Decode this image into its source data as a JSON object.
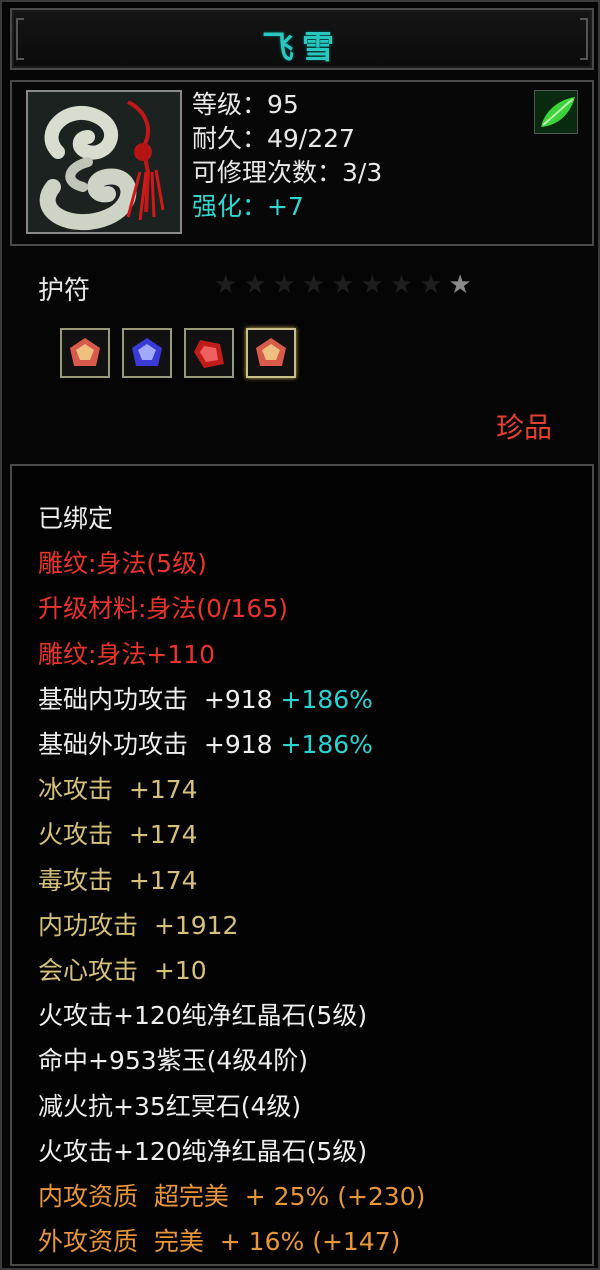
{
  "title": "飞雪",
  "item": {
    "stats": [
      {
        "label": "等级：95",
        "color": "white"
      },
      {
        "label": "耐久：49/227",
        "color": "white"
      },
      {
        "label": "可修理次数：3/3",
        "color": "white"
      },
      {
        "label": "强化：+7",
        "color": "cyan"
      }
    ],
    "category": "护符",
    "stars_total": 9,
    "stars_lit": 1,
    "gems": [
      "red-yellow-gem",
      "blue-gem",
      "red-gem",
      "red-yellow-gem"
    ],
    "rarity": "珍品"
  },
  "attributes": {
    "bound": "已绑定",
    "lines": [
      {
        "text": "雕纹:身法(5级)",
        "color": "red"
      },
      {
        "text": "升级材料:身法(0/165)",
        "color": "red"
      },
      {
        "text": "雕纹:身法+110",
        "color": "red"
      },
      {
        "text": "基础内功攻击  +918 ",
        "pct": "+186%",
        "color": "white"
      },
      {
        "text": "基础外功攻击  +918 ",
        "pct": "+186%",
        "color": "white"
      },
      {
        "text": "冰攻击  +174",
        "color": "gold"
      },
      {
        "text": "火攻击  +174",
        "color": "gold"
      },
      {
        "text": "毒攻击  +174",
        "color": "gold"
      },
      {
        "text": "内功攻击  +1912",
        "color": "gold"
      },
      {
        "text": "会心攻击  +10",
        "color": "gold"
      },
      {
        "text": "火攻击+120纯净红晶石(5级)",
        "color": "white"
      },
      {
        "text": "命中+953紫玉(4级4阶)",
        "color": "white"
      },
      {
        "text": "减火抗+35红冥石(4级)",
        "color": "white"
      },
      {
        "text": "火攻击+120纯净红晶石(5级)",
        "color": "white"
      },
      {
        "text": "内攻资质  超完美  + 25% (+230)",
        "color": "orange"
      },
      {
        "text": "外攻资质  完美  + 16% (+147)",
        "color": "orange"
      }
    ]
  },
  "colors": {
    "title": "#28c8c0",
    "red": "#e8342a",
    "gold": "#d6c07a",
    "orange": "#e8963a",
    "cyan": "#2ad2d0"
  }
}
